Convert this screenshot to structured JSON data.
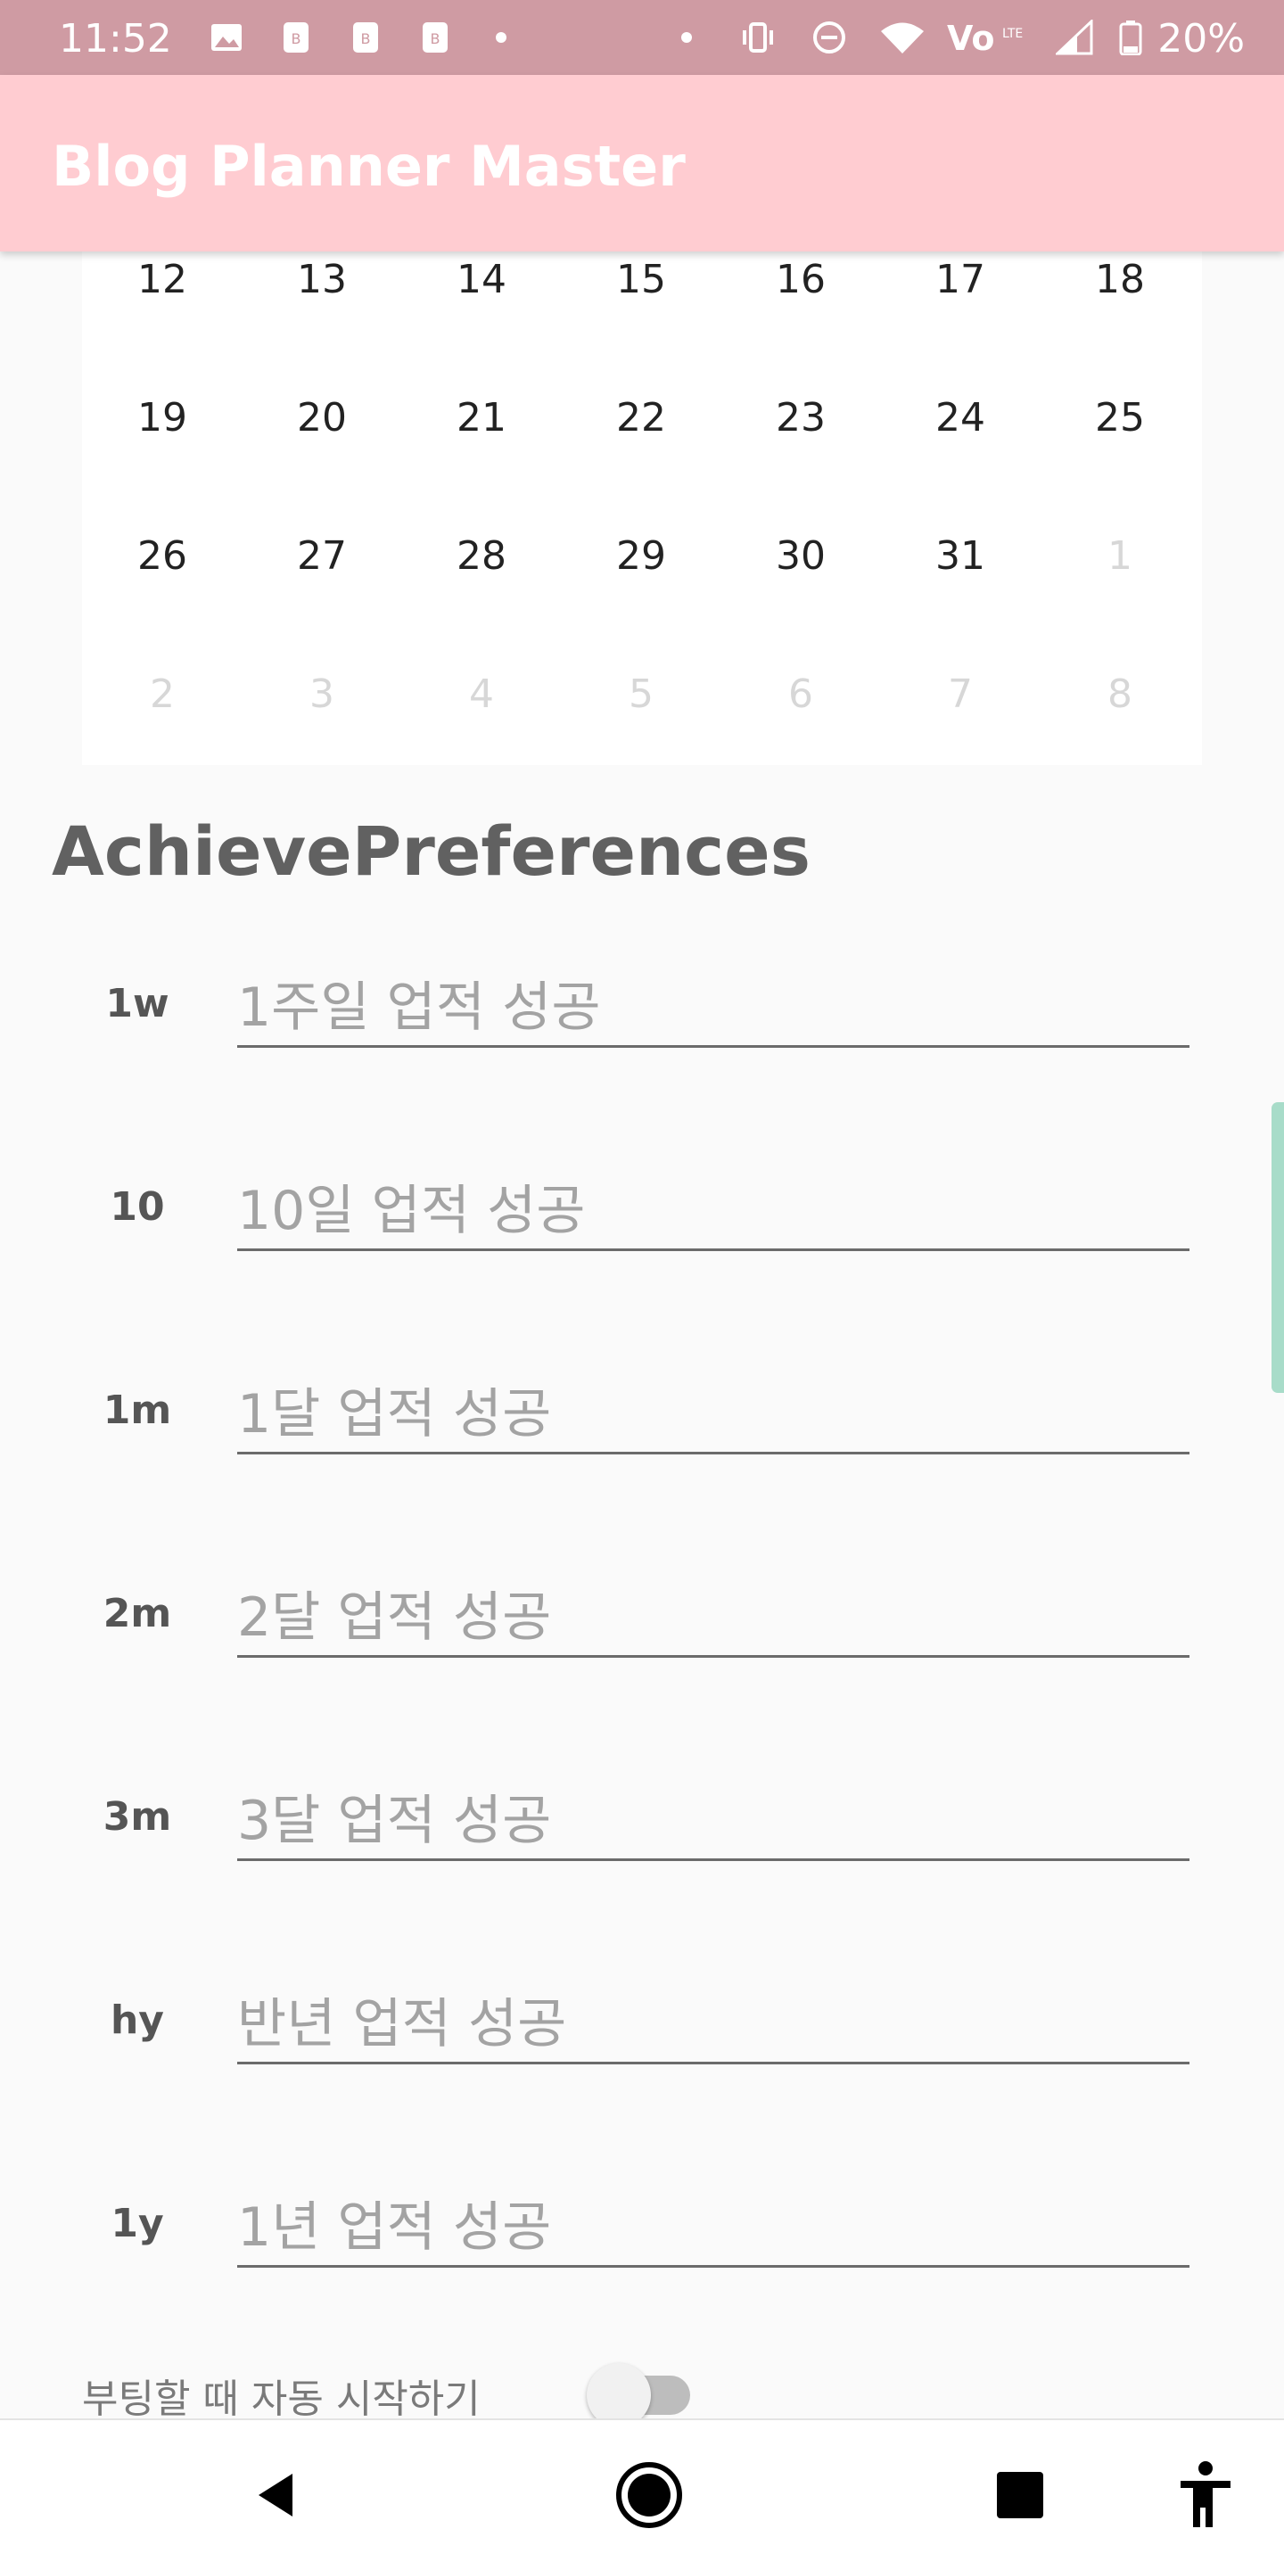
{
  "status_bar": {
    "time": "11:52",
    "battery": "20%",
    "icons": [
      "image-icon",
      "notification-icon",
      "notification-icon",
      "notification-icon",
      "dot-icon",
      "dot-icon",
      "vibrate-icon",
      "do-not-disturb-icon",
      "wifi-icon",
      "volte-icon",
      "signal-icon",
      "battery-icon"
    ]
  },
  "app_bar": {
    "title": "Blog Planner Master",
    "color": "#ffccd1"
  },
  "calendar": {
    "weeks": [
      [
        {
          "d": "12",
          "dim": false
        },
        {
          "d": "13",
          "dim": false
        },
        {
          "d": "14",
          "dim": false
        },
        {
          "d": "15",
          "dim": false
        },
        {
          "d": "16",
          "dim": false
        },
        {
          "d": "17",
          "dim": false
        },
        {
          "d": "18",
          "dim": false
        }
      ],
      [
        {
          "d": "19",
          "dim": false
        },
        {
          "d": "20",
          "dim": false
        },
        {
          "d": "21",
          "dim": false
        },
        {
          "d": "22",
          "dim": false
        },
        {
          "d": "23",
          "dim": false
        },
        {
          "d": "24",
          "dim": false
        },
        {
          "d": "25",
          "dim": false
        }
      ],
      [
        {
          "d": "26",
          "dim": false
        },
        {
          "d": "27",
          "dim": false
        },
        {
          "d": "28",
          "dim": false
        },
        {
          "d": "29",
          "dim": false
        },
        {
          "d": "30",
          "dim": false
        },
        {
          "d": "31",
          "dim": false
        },
        {
          "d": "1",
          "dim": true
        }
      ],
      [
        {
          "d": "2",
          "dim": true
        },
        {
          "d": "3",
          "dim": true
        },
        {
          "d": "4",
          "dim": true
        },
        {
          "d": "5",
          "dim": true
        },
        {
          "d": "6",
          "dim": true
        },
        {
          "d": "7",
          "dim": true
        },
        {
          "d": "8",
          "dim": true
        }
      ]
    ]
  },
  "achieve": {
    "title": "AchievePreferences",
    "items": [
      {
        "label": "1w",
        "placeholder": "1주일 업적 성공",
        "value": ""
      },
      {
        "label": "10",
        "placeholder": "10일 업적 성공",
        "value": ""
      },
      {
        "label": "1m",
        "placeholder": "1달 업적 성공",
        "value": ""
      },
      {
        "label": "2m",
        "placeholder": "2달 업적 성공",
        "value": ""
      },
      {
        "label": "3m",
        "placeholder": "3달 업적 성공",
        "value": ""
      },
      {
        "label": "hy",
        "placeholder": "반년 업적 성공",
        "value": ""
      },
      {
        "label": "1y",
        "placeholder": "1년 업적 성공",
        "value": ""
      }
    ]
  },
  "autostart": {
    "label": "부팅할 때 자동 시작하기",
    "enabled": false
  },
  "nav_bar": {
    "buttons": [
      "back-icon",
      "home-icon",
      "recents-icon",
      "accessibility-icon"
    ]
  }
}
